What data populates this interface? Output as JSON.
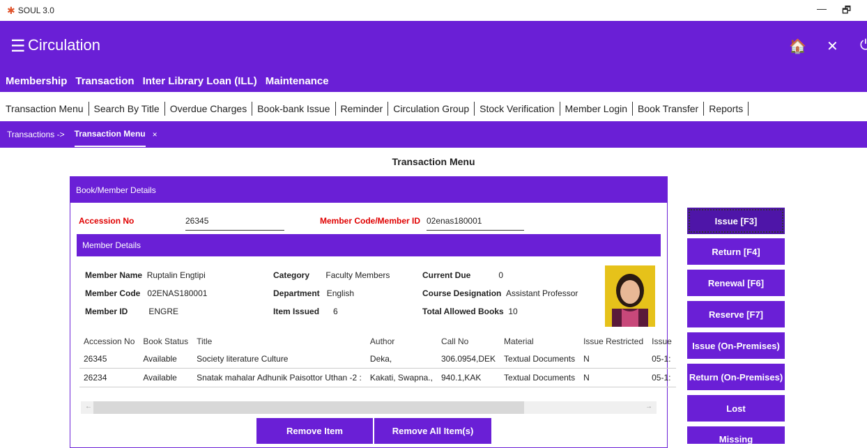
{
  "window": {
    "title": "SOUL 3.0",
    "minimize": "—",
    "restore": "🗗"
  },
  "header": {
    "title": "Circulation",
    "home": "🏠",
    "close": "✕",
    "extra": "⏻"
  },
  "nav1": [
    "Membership",
    "Transaction",
    "Inter Library Loan (ILL)",
    "Maintenance"
  ],
  "nav2": [
    "Transaction Menu",
    "Search By Title",
    "Overdue Charges",
    "Book-bank Issue",
    "Reminder",
    "Circulation Group",
    "Stock Verification",
    "Member Login",
    "Book Transfer",
    "Reports"
  ],
  "breadcrumb": {
    "root": "Transactions ->",
    "tab": "Transaction Menu",
    "close": "×"
  },
  "page_title": "Transaction Menu",
  "panel": {
    "title": "Book/Member Details",
    "accession_label": "Accession No",
    "accession_value": "26345",
    "member_label": "Member Code/Member ID",
    "member_value": "02enas180001"
  },
  "member": {
    "title": "Member Details",
    "name_label": "Member Name",
    "name": "Ruptalin Engtipi",
    "code_label": "Member Code",
    "code": "02ENAS180001",
    "id_label": "Member ID",
    "id": "ENGRE",
    "category_label": "Category",
    "category": "Faculty Members",
    "dept_label": "Department",
    "dept": "English",
    "issued_label": "Item Issued",
    "issued": "6",
    "due_label": "Current Due",
    "due": "0",
    "course_label": "Course Designation",
    "course": "Assistant Professor",
    "allowed_label": "Total Allowed Books",
    "allowed": "10"
  },
  "table": {
    "headers": [
      "Accession No",
      "Book Status",
      "Title",
      "Author",
      "Call No",
      "Material",
      "Issue Restricted",
      "Issue"
    ],
    "rows": [
      [
        "26345",
        "Available",
        "Society literature Culture",
        "Deka,",
        "306.0954,DEK",
        "Textual Documents",
        "N",
        "05-1:"
      ],
      [
        "26234",
        "Available",
        "Snatak mahalar Adhunik Paisottor Uthan -2 :",
        "Kakati, Swapna.,",
        "940.1,KAK",
        "Textual Documents",
        "N",
        "05-1:"
      ]
    ]
  },
  "buttons": {
    "remove_item": "Remove Item",
    "remove_all": "Remove All Item(s)"
  },
  "actions": [
    "Issue [F3]",
    "Return [F4]",
    "Renewal [F6]",
    "Reserve [F7]",
    "Issue (On-Premises)",
    "Return (On-Premises)",
    "Lost",
    "Missing"
  ],
  "colors": {
    "primary": "#6a1fd6",
    "required_label": "#e00000"
  }
}
